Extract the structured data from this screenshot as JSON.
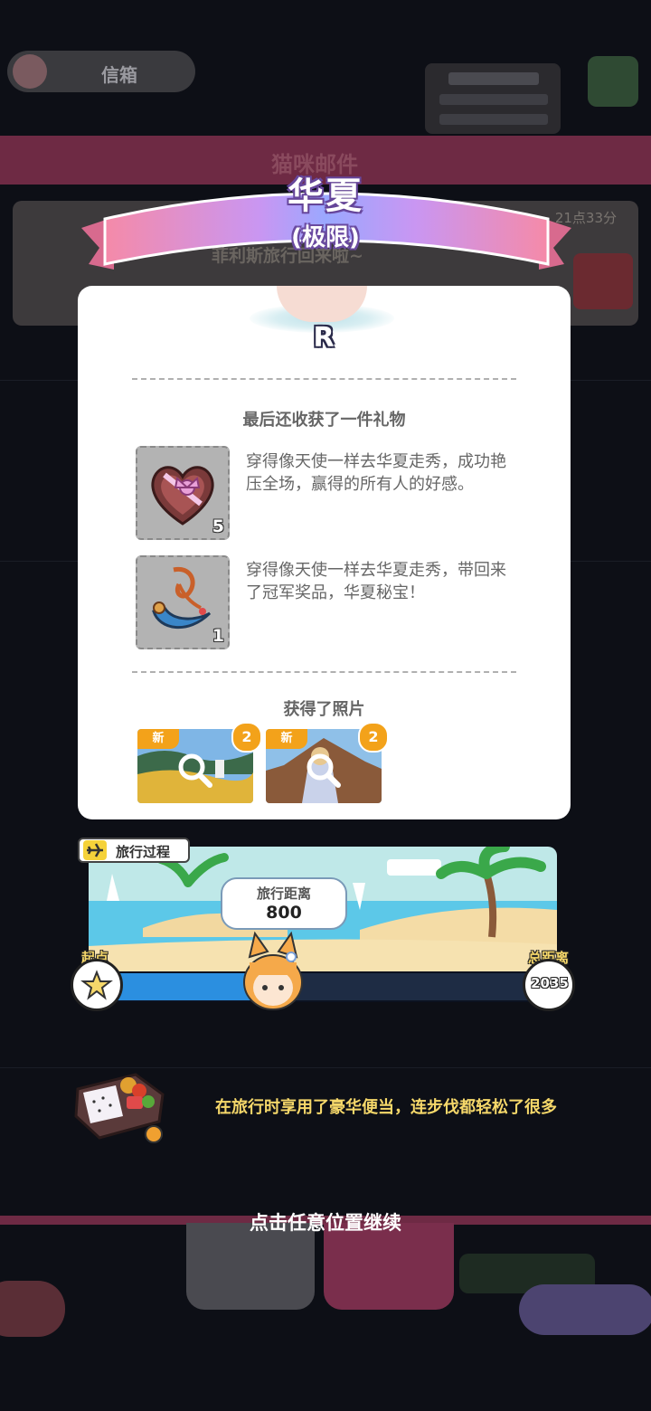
{
  "background": {
    "mailbox_label": "信箱",
    "mail_header": "猫咪邮件",
    "mail_preview": "菲利斯旅行回来啦~",
    "mail_time": "21点33分"
  },
  "ribbon": {
    "title": "华夏",
    "subtitle": "(极限)"
  },
  "card": {
    "rank": "R",
    "gift_section_title": "最后还收获了一件礼物",
    "gifts": [
      {
        "icon": "heart-chocolate-box-icon",
        "count": "5",
        "desc": "穿得像天使一样去华夏走秀，成功艳压全场，赢得的所有人的好感。"
      },
      {
        "icon": "jade-pendant-icon",
        "count": "1",
        "desc": "穿得像天使一样去华夏走秀，带回来了冠军奖品，华夏秘宝！"
      }
    ],
    "photo_section_title": "获得了照片",
    "photos": [
      {
        "badge": "新",
        "count": "2"
      },
      {
        "badge": "新",
        "count": "2"
      }
    ]
  },
  "travel": {
    "tag_label": "旅行过程",
    "distance_label": "旅行距离",
    "distance_value": "800",
    "start_label": "起点",
    "total_label": "总距离",
    "total_value": "2035",
    "progress": 0.393
  },
  "event": {
    "text": "在旅行时享用了豪华便当，连步伐都轻松了很多",
    "icon": "bento-box-icon"
  },
  "continue_hint": "点击任意位置继续",
  "colors": {
    "accent_orange": "#f3a21a",
    "event_yellow": "#f6d86a",
    "progress_blue": "#2b8fe0"
  }
}
